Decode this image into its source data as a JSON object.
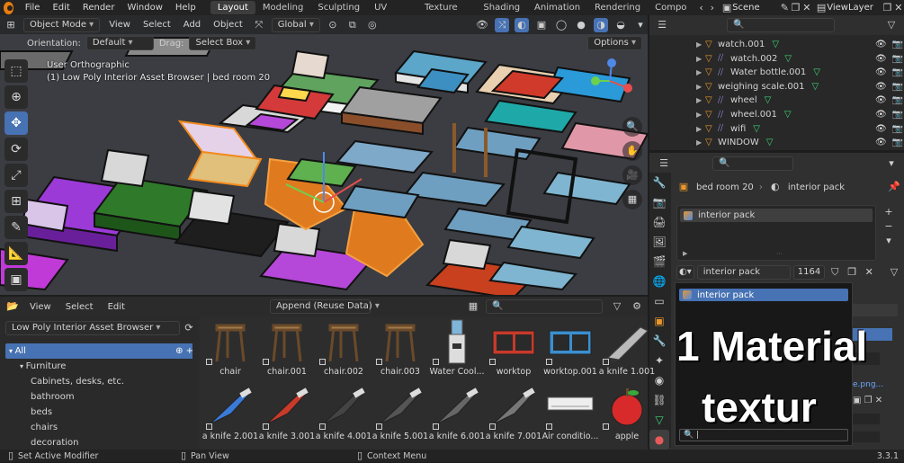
{
  "topbar": {
    "menus": [
      "File",
      "Edit",
      "Render",
      "Window",
      "Help"
    ],
    "workspaces": [
      "Layout",
      "Modeling",
      "Sculpting",
      "UV Editing",
      "Texture Paint",
      "Shading",
      "Animation",
      "Rendering",
      "Compo"
    ],
    "active_workspace": "Layout",
    "scene_label": "Scene",
    "viewlayer_label": "ViewLayer"
  },
  "viewport": {
    "mode": "Object Mode",
    "menus": [
      "View",
      "Select",
      "Add",
      "Object"
    ],
    "transform": "Global",
    "orientation_label": "Orientation:",
    "orientation_value": "Default",
    "drag_label": "Drag:",
    "drag_value": "Select Box",
    "options_label": "Options",
    "view_name": "User Orthographic",
    "view_info": "(1) Low Poly Interior Asset Browser | bed room 20"
  },
  "outliner": {
    "rows": [
      {
        "label": "watch.001",
        "kind": "tri"
      },
      {
        "label": "watch.002",
        "kind": "mod"
      },
      {
        "label": "Water bottle.001",
        "kind": "mod"
      },
      {
        "label": "weighing scale.001",
        "kind": "tri"
      },
      {
        "label": "wheel",
        "kind": "mod"
      },
      {
        "label": "wheel.001",
        "kind": "mod"
      },
      {
        "label": "wifi",
        "kind": "mod"
      },
      {
        "label": "WINDOW",
        "kind": "tri"
      }
    ]
  },
  "properties": {
    "breadcrumb_object": "bed room 20",
    "breadcrumb_material": "interior pack",
    "slot_label": "interior pack",
    "material_name": "interior pack",
    "user_count": "1164",
    "popup_item": "interior pack",
    "file_label": "e.png..."
  },
  "asset_browser": {
    "menus": [
      "View",
      "Select",
      "Edit"
    ],
    "import_mode": "Append (Reuse Data)",
    "library": "Low Poly Interior Asset Browser",
    "tree": [
      {
        "label": "All",
        "level": 0,
        "selected": true
      },
      {
        "label": "Furniture",
        "level": 1,
        "selected": false
      },
      {
        "label": "Cabinets, desks, etc.",
        "level": 2,
        "selected": false
      },
      {
        "label": "bathroom",
        "level": 2,
        "selected": false
      },
      {
        "label": "beds",
        "level": 2,
        "selected": false
      },
      {
        "label": "chairs",
        "level": 2,
        "selected": false
      },
      {
        "label": "decoration",
        "level": 2,
        "selected": false
      }
    ],
    "assets_row1": [
      "chair",
      "chair.001",
      "chair.002",
      "chair.003",
      "Water Cool...",
      "worktop",
      "worktop.001",
      "a knife 1.001"
    ],
    "assets_row2": [
      "a knife 2.001",
      "a knife 3.001",
      "a knife 4.001",
      "a knife 5.001",
      "a knife 6.001",
      "a knife 7.001",
      "Air conditio...",
      "apple"
    ]
  },
  "statusbar": {
    "left": "Set Active Modifier",
    "middle": "Pan View",
    "right": "Context Menu",
    "version": "3.3.1"
  },
  "overlay": {
    "line1": "1 Material",
    "line2": "textur"
  }
}
